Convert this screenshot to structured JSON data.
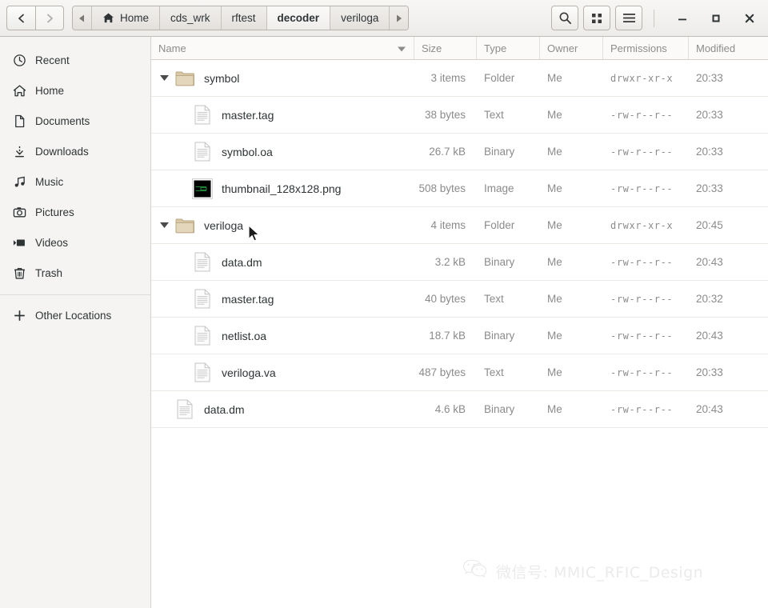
{
  "window": {
    "minimize_label": "–",
    "maximize_label": "□",
    "close_label": "×"
  },
  "header": {
    "back_label": "Back",
    "forward_label": "Forward",
    "breadcrumb_prev_label": "◂",
    "breadcrumb_next_label": "▸",
    "breadcrumbs": [
      {
        "label": "Home",
        "icon": "home-icon",
        "active": false
      },
      {
        "label": "cds_wrk",
        "icon": "",
        "active": false
      },
      {
        "label": "rftest",
        "icon": "",
        "active": false
      },
      {
        "label": "decoder",
        "icon": "",
        "active": true
      },
      {
        "label": "veriloga",
        "icon": "",
        "active": false
      }
    ],
    "tools": [
      {
        "name": "search-icon",
        "label": "Search"
      },
      {
        "name": "grid-view-icon",
        "label": "View options"
      },
      {
        "name": "hamburger-menu-icon",
        "label": "Main menu"
      }
    ]
  },
  "sidebar": {
    "items": [
      {
        "label": "Recent",
        "icon": "clock-icon"
      },
      {
        "label": "Home",
        "icon": "home-icon"
      },
      {
        "label": "Documents",
        "icon": "document-icon"
      },
      {
        "label": "Downloads",
        "icon": "download-icon"
      },
      {
        "label": "Music",
        "icon": "music-note-icon"
      },
      {
        "label": "Pictures",
        "icon": "camera-icon"
      },
      {
        "label": "Videos",
        "icon": "video-icon"
      },
      {
        "label": "Trash",
        "icon": "trash-icon"
      }
    ],
    "other_locations": {
      "label": "Other Locations",
      "icon": "plus-icon"
    }
  },
  "filelist": {
    "columns": [
      {
        "key": "name",
        "label": "Name",
        "sorted": true
      },
      {
        "key": "size",
        "label": "Size",
        "sorted": false
      },
      {
        "key": "type",
        "label": "Type",
        "sorted": false
      },
      {
        "key": "owner",
        "label": "Owner",
        "sorted": false
      },
      {
        "key": "permissions",
        "label": "Permissions",
        "sorted": false
      },
      {
        "key": "modified",
        "label": "Modified",
        "sorted": false
      }
    ],
    "rows": [
      {
        "name": "symbol",
        "size": "3 items",
        "type": "Folder",
        "owner": "Me",
        "permissions": "drwxr-xr-x",
        "modified": "20:33",
        "icon": "folder-icon",
        "depth": 0,
        "expander": "expanded"
      },
      {
        "name": "master.tag",
        "size": "38 bytes",
        "type": "Text",
        "owner": "Me",
        "permissions": "-rw-r--r--",
        "modified": "20:33",
        "icon": "text-file-icon",
        "depth": 1,
        "expander": "none"
      },
      {
        "name": "symbol.oa",
        "size": "26.7 kB",
        "type": "Binary",
        "owner": "Me",
        "permissions": "-rw-r--r--",
        "modified": "20:33",
        "icon": "text-file-icon",
        "depth": 1,
        "expander": "none"
      },
      {
        "name": "thumbnail_128x128.png",
        "size": "508 bytes",
        "type": "Image",
        "owner": "Me",
        "permissions": "-rw-r--r--",
        "modified": "20:33",
        "icon": "image-thumb-icon",
        "depth": 1,
        "expander": "none"
      },
      {
        "name": "veriloga",
        "size": "4 items",
        "type": "Folder",
        "owner": "Me",
        "permissions": "drwxr-xr-x",
        "modified": "20:45",
        "icon": "folder-icon",
        "depth": 0,
        "expander": "expanded"
      },
      {
        "name": "data.dm",
        "size": "3.2 kB",
        "type": "Binary",
        "owner": "Me",
        "permissions": "-rw-r--r--",
        "modified": "20:43",
        "icon": "text-file-icon",
        "depth": 1,
        "expander": "none"
      },
      {
        "name": "master.tag",
        "size": "40 bytes",
        "type": "Text",
        "owner": "Me",
        "permissions": "-rw-r--r--",
        "modified": "20:32",
        "icon": "text-file-icon",
        "depth": 1,
        "expander": "none"
      },
      {
        "name": "netlist.oa",
        "size": "18.7 kB",
        "type": "Binary",
        "owner": "Me",
        "permissions": "-rw-r--r--",
        "modified": "20:43",
        "icon": "text-file-icon",
        "depth": 1,
        "expander": "none"
      },
      {
        "name": "veriloga.va",
        "size": "487 bytes",
        "type": "Text",
        "owner": "Me",
        "permissions": "-rw-r--r--",
        "modified": "20:33",
        "icon": "text-file-icon",
        "depth": 1,
        "expander": "none"
      },
      {
        "name": "data.dm",
        "size": "4.6 kB",
        "type": "Binary",
        "owner": "Me",
        "permissions": "-rw-r--r--",
        "modified": "20:43",
        "icon": "text-file-icon",
        "depth": 0,
        "expander": "none"
      }
    ]
  },
  "watermark": {
    "text": "微信号: MMIC_RFIC_Design",
    "icon": "wechat-icon"
  },
  "colors": {
    "headerbar_top": "#f7f6f5",
    "headerbar_bottom": "#eeecea",
    "sidebar_bg": "#f5f4f2",
    "folder_icon": "#d5c39b",
    "text_primary": "#2e3436",
    "text_secondary": "#8b8b8b",
    "row_divider": "#edeae6",
    "watermark": "#ebebeb"
  }
}
